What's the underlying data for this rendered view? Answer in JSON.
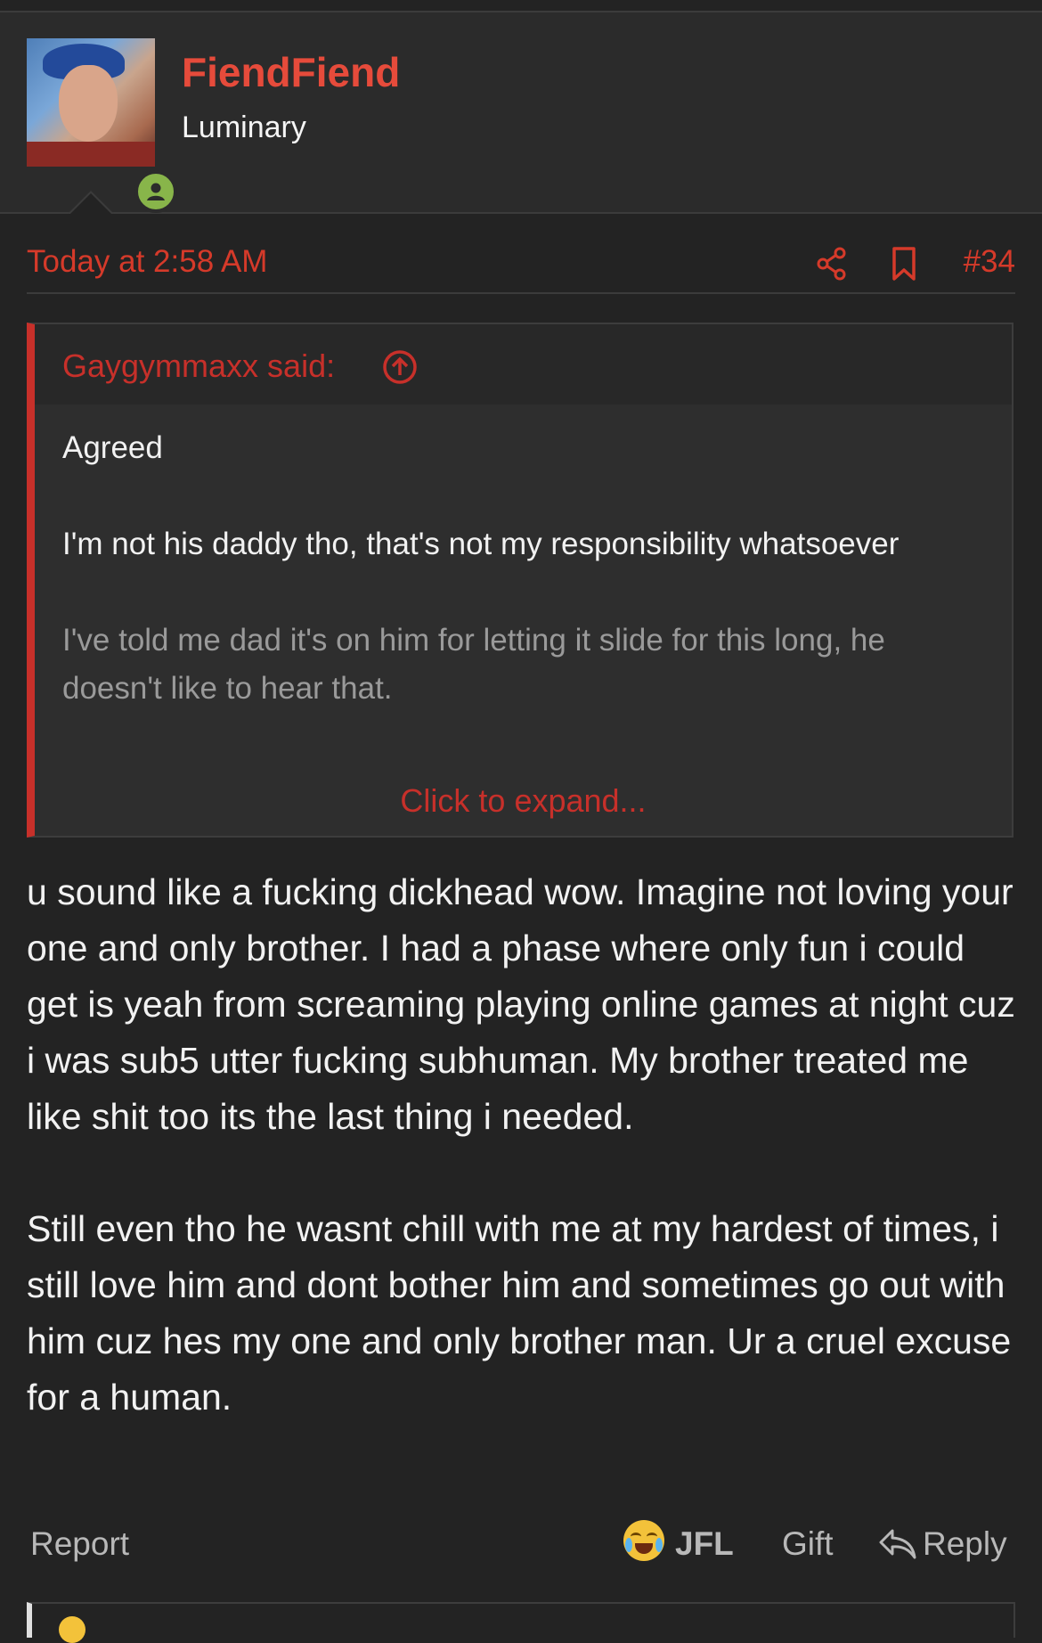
{
  "user": {
    "name": "FiendFiend",
    "title": "Luminary",
    "online": true
  },
  "post": {
    "date": "Today at 2:58 AM",
    "number": "#34",
    "body": [
      "u sound like a fucking dickhead wow. Imagine not loving your one and only brother. I had a phase where only fun i could get is yeah from screaming playing online games at night cuz i was sub5 utter fucking subhuman. My brother treated me like shit too its the last thing i needed.",
      "Still even tho he wasnt chill with me at my hardest of times, i still love him and dont bother him and sometimes go out with him cuz hes my one and only brother man. Ur a cruel excuse for a human."
    ]
  },
  "quote": {
    "author": "Gaygymmaxx said:",
    "lines": [
      "Agreed",
      "I'm not his daddy tho, that's not my responsibility whatsoever",
      "I've told me dad it's on him for letting it slide for this long, he doesn't like to hear that."
    ],
    "expand_label": "Click to expand..."
  },
  "actions": {
    "report": "Report",
    "reaction": "JFL",
    "gift": "Gift",
    "reply": "Reply"
  },
  "colors": {
    "accent": "#e64b3b",
    "link": "#d53a2a",
    "online": "#88b54a",
    "background": "#232323"
  },
  "icons": [
    "share-icon",
    "bookmark-icon",
    "jump-to-quote-icon",
    "reply-icon",
    "online-status-icon",
    "laughing-crying-emoji"
  ]
}
